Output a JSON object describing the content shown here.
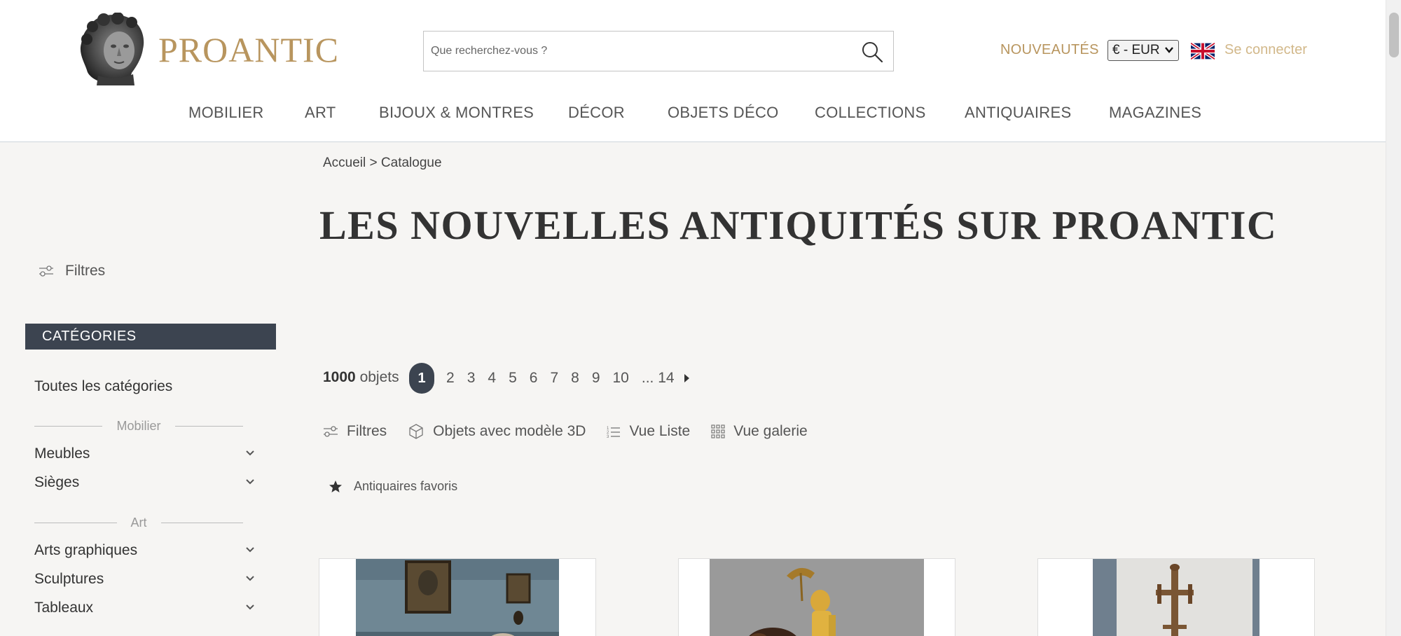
{
  "header": {
    "brand": "PROANTIC",
    "search_placeholder": "Que recherchez-vous ?",
    "new_label": "NOUVEAUTÉS",
    "currency": "€ - EUR",
    "login_label": "Se connecter",
    "flag_icon": "uk-flag-icon",
    "search_icon": "search-icon"
  },
  "nav": {
    "items": [
      "MOBILIER",
      "ART",
      "BIJOUX & MONTRES",
      "DÉCOR",
      "OBJETS DÉCO",
      "COLLECTIONS",
      "ANTIQUAIRES",
      "MAGAZINES"
    ]
  },
  "breadcrumb": "Accueil > Catalogue",
  "page_title": "LES NOUVELLES ANTIQUITÉS SUR PROANTIC",
  "sidebar": {
    "filters_label": "Filtres",
    "categories_title": "CATÉGORIES",
    "all_categories": "Toutes les catégories",
    "groups": [
      {
        "title": "Mobilier",
        "items": [
          "Meubles",
          "Sièges"
        ]
      },
      {
        "title": "Art",
        "items": [
          "Arts graphiques",
          "Sculptures",
          "Tableaux"
        ]
      }
    ]
  },
  "results": {
    "count_number": "1000",
    "count_label": "objets",
    "pages": [
      "1",
      "2",
      "3",
      "4",
      "5",
      "6",
      "7",
      "8",
      "9",
      "10",
      "... 14"
    ],
    "current_page": "1"
  },
  "toolbar": {
    "filters": "Filtres",
    "model3d": "Objets avec modèle 3D",
    "list_view": "Vue Liste",
    "gallery_view": "Vue galerie"
  },
  "favorites_label": "Antiquaires favoris",
  "colors": {
    "brand_gold": "#b8955e",
    "dark_slate": "#3c4450",
    "background": "#f6f5f3"
  }
}
